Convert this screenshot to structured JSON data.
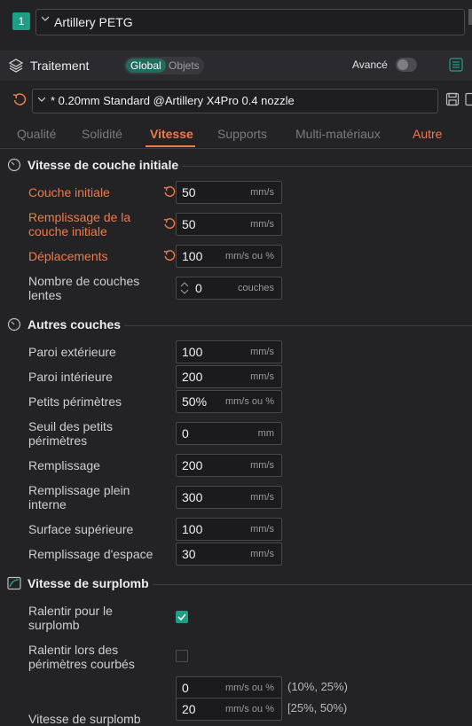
{
  "material": {
    "index": "1",
    "name": "Artillery PETG"
  },
  "process": {
    "title": "Traitement",
    "scope_global": "Global",
    "scope_objects": "Objets",
    "advanced_label": "Avancé",
    "advanced_on": false
  },
  "preset": {
    "name": "* 0.20mm Standard @Artillery X4Pro 0.4 nozzle"
  },
  "tabs": [
    "Qualité",
    "Solidité",
    "Vitesse",
    "Supports",
    "Multi-matériaux",
    "Autre"
  ],
  "sections": {
    "initial": {
      "title": "Vitesse de couche initiale",
      "rows": [
        {
          "label": "Couche initiale",
          "value": "50",
          "unit": "mm/s"
        },
        {
          "label": "Remplissage de la couche initiale",
          "value": "50",
          "unit": "mm/s"
        },
        {
          "label": "Déplacements",
          "value": "100",
          "unit": "mm/s ou %"
        },
        {
          "label": "Nombre de couches lentes",
          "value": "0",
          "unit": "couches"
        }
      ]
    },
    "other": {
      "title": "Autres couches",
      "rows": [
        {
          "label": "Paroi extérieure",
          "value": "100",
          "unit": "mm/s"
        },
        {
          "label": "Paroi intérieure",
          "value": "200",
          "unit": "mm/s"
        },
        {
          "label": "Petits périmètres",
          "value": "50%",
          "unit": "mm/s ou %"
        },
        {
          "label": "Seuil des petits périmètres",
          "value": "0",
          "unit": "mm"
        },
        {
          "label": "Remplissage",
          "value": "200",
          "unit": "mm/s"
        },
        {
          "label": "Remplissage plein interne",
          "value": "300",
          "unit": "mm/s"
        },
        {
          "label": "Surface supérieure",
          "value": "100",
          "unit": "mm/s"
        },
        {
          "label": "Remplissage d'espace",
          "value": "30",
          "unit": "mm/s"
        }
      ]
    },
    "overhang": {
      "title": "Vitesse de surplomb",
      "rows": [
        {
          "label": "Ralentir pour le surplomb",
          "checked": true
        },
        {
          "label": "Ralentir lors des périmètres courbés",
          "checked": false
        }
      ],
      "speed_label": "Vitesse de surplomb",
      "speeds": [
        {
          "value": "0",
          "unit": "mm/s ou %",
          "range": "(10%, 25%)"
        },
        {
          "value": "20",
          "unit": "mm/s ou %",
          "range": "[25%, 50%)"
        }
      ]
    }
  },
  "colors": {
    "accent": "#1f9e86",
    "modified": "#f07a4a",
    "background": "#232326"
  }
}
